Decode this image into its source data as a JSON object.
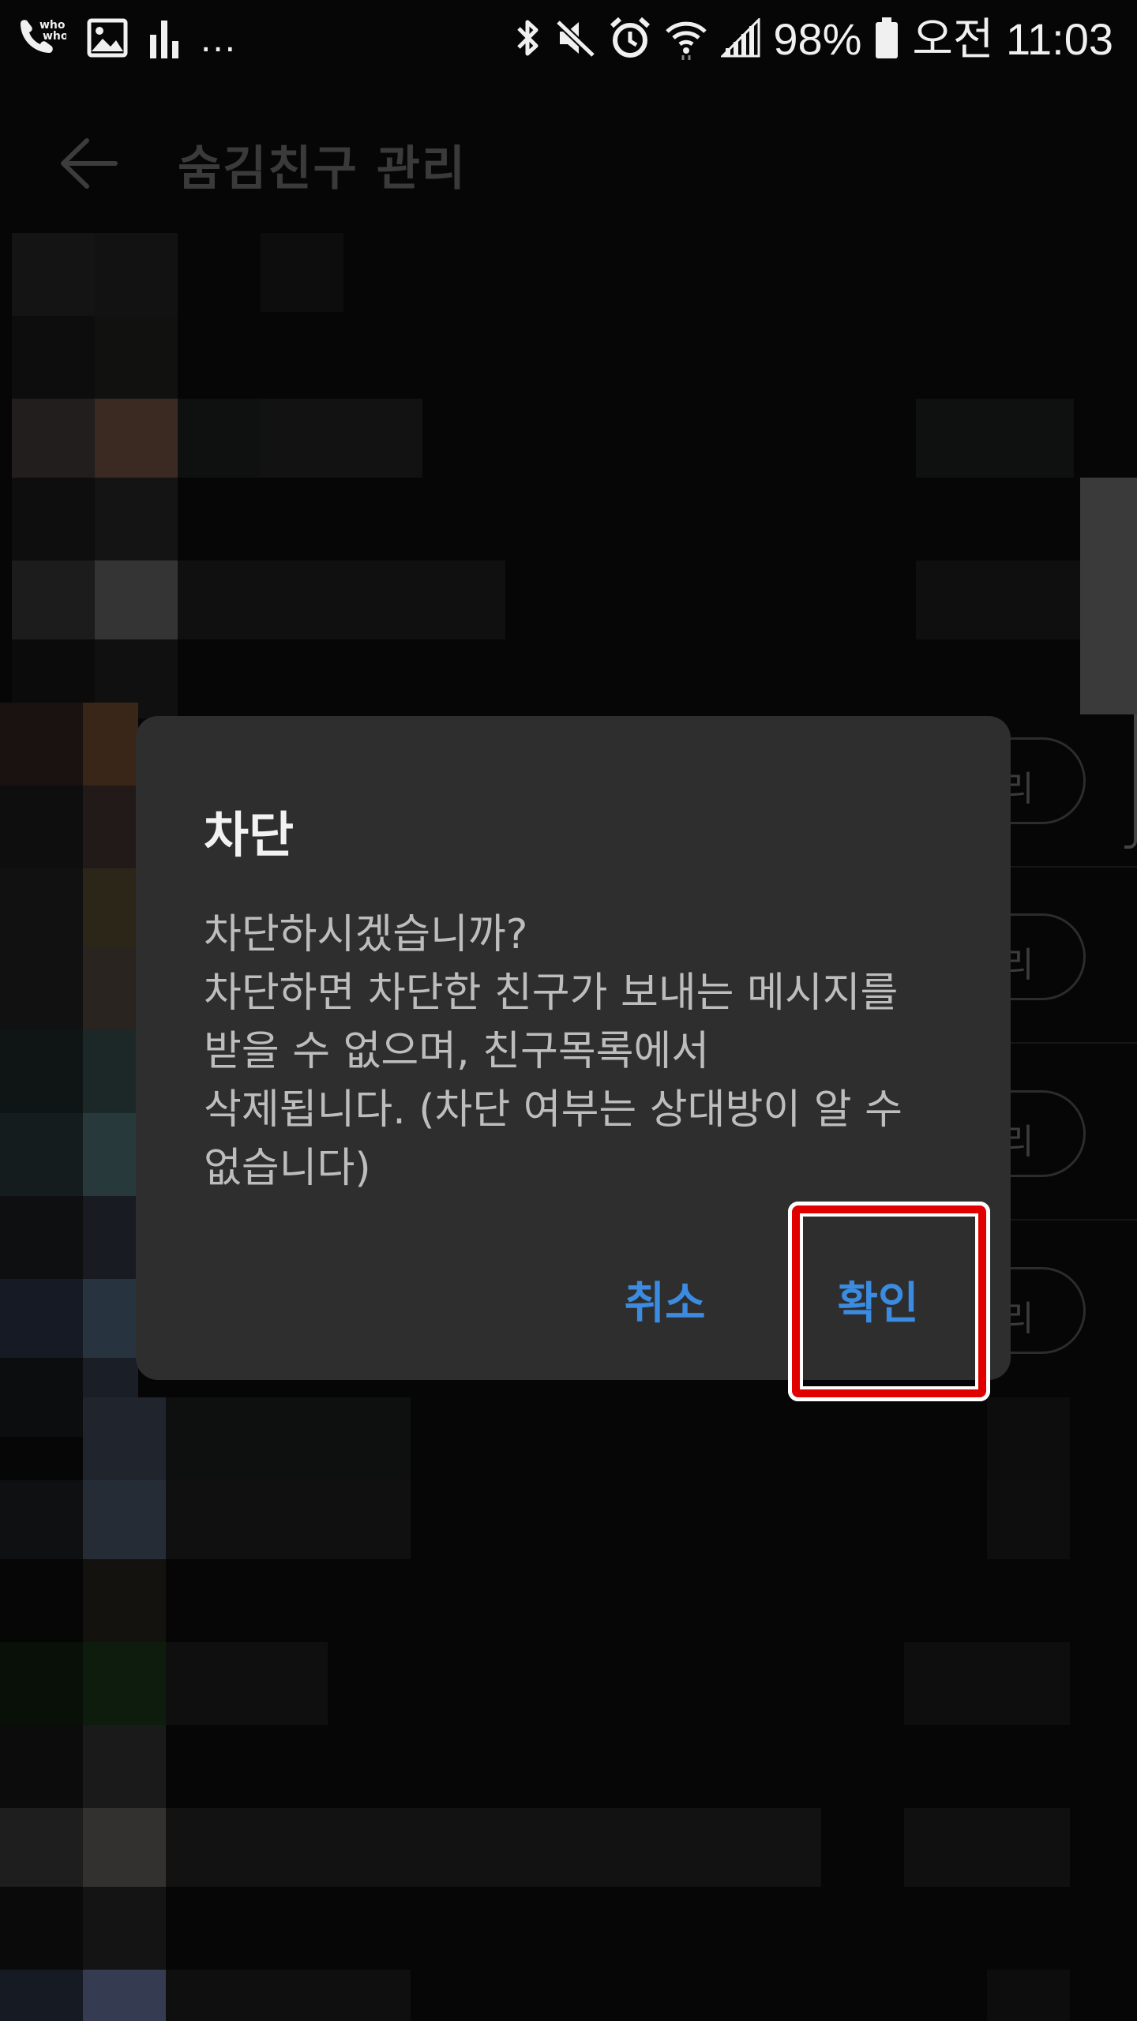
{
  "status_bar": {
    "left_icons": [
      "whowho-call-icon",
      "gallery-icon",
      "signal-chart-icon"
    ],
    "more": "...",
    "right_icons": [
      "bluetooth-icon",
      "mute-icon",
      "alarm-icon",
      "wifi-icon",
      "cell-signal-icon"
    ],
    "battery": "98%",
    "time": "오전 11:03"
  },
  "app_bar": {
    "back_icon": "back-arrow-icon",
    "title": "숨김친구 관리"
  },
  "list": {
    "manage_label": "리"
  },
  "dialog": {
    "title": "차단",
    "message": "차단하시겠습니까?\n차단하면 차단한 친구가 보내는 메시지를\n받을 수 없으며, 친구목록에서\n삭제됩니다. (차단 여부는 상대방이 알 수\n없습니다)",
    "cancel_label": "취소",
    "confirm_label": "확인"
  },
  "colors": {
    "accent": "#3b8be0",
    "highlight": "#e00000",
    "dialog_bg": "#2e2e2e"
  }
}
